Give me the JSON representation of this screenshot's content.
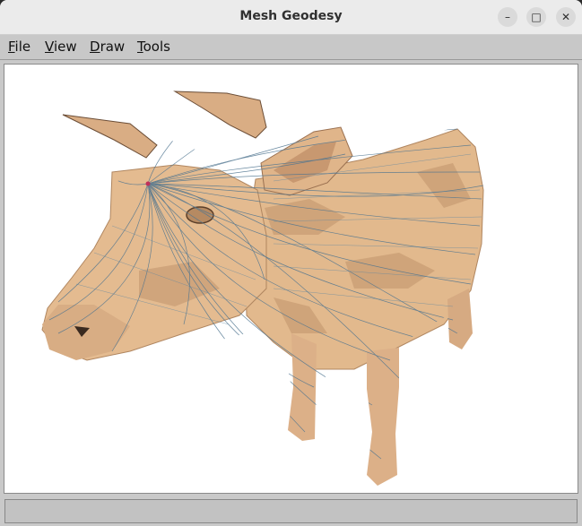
{
  "window": {
    "title": "Mesh Geodesy"
  },
  "controls": {
    "minimize_label": "–",
    "maximize_label": "□",
    "close_label": "✕"
  },
  "menu": {
    "items": [
      {
        "label": "File"
      },
      {
        "label": "View"
      },
      {
        "label": "Draw"
      },
      {
        "label": "Tools"
      }
    ]
  },
  "viewport": {
    "content": "3D cow mesh with geodesic lines",
    "mesh_color": "#e2b98d",
    "line_color": "#4f7590"
  },
  "status": {
    "text": ""
  }
}
